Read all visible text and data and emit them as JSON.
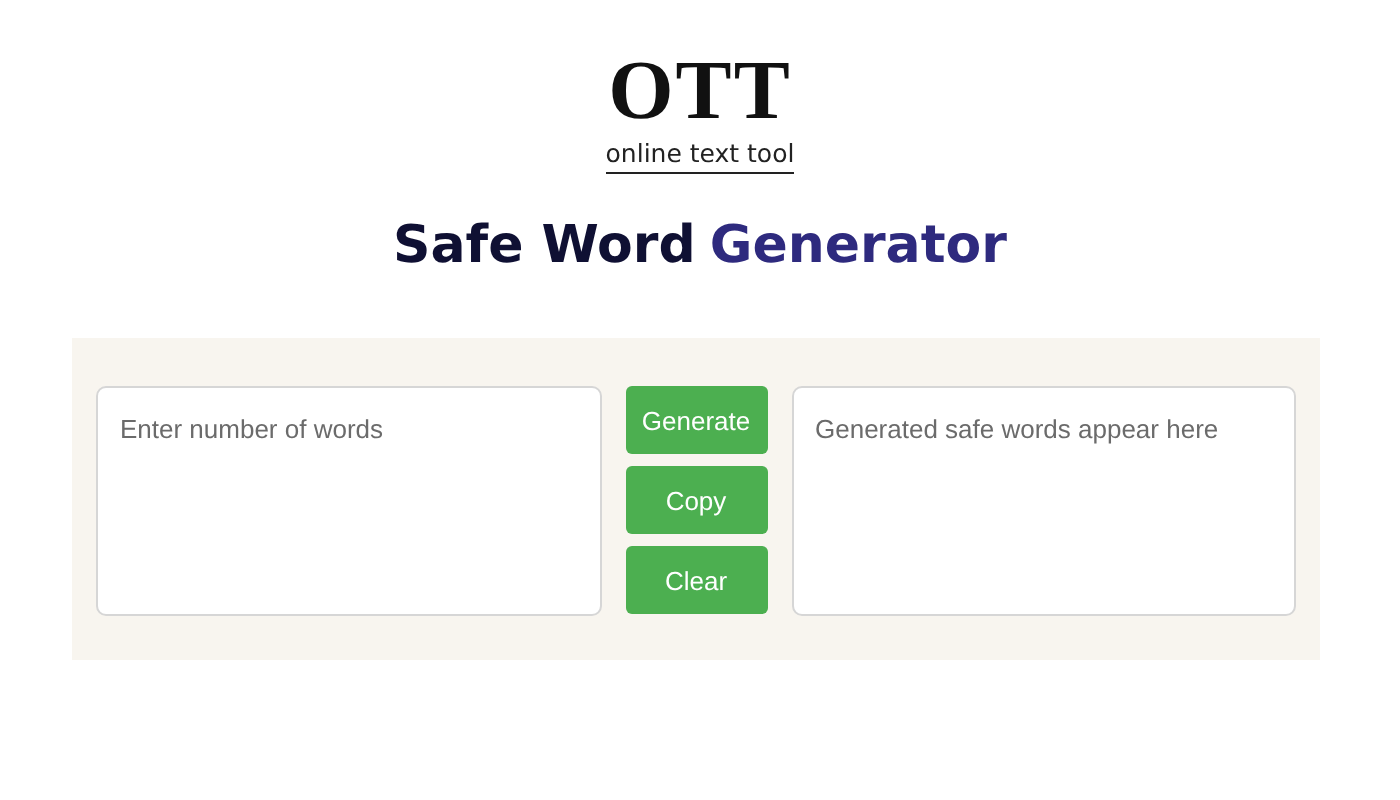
{
  "logo": {
    "mark": "OTT",
    "tagline": "online text tool"
  },
  "title": [
    {
      "text": "Safe Word",
      "kind": "plain"
    },
    {
      "text": "Generator",
      "kind": "accent"
    }
  ],
  "input": {
    "placeholder": "Enter number of words"
  },
  "buttons": [
    "Generate",
    "Copy",
    "Clear"
  ],
  "output": {
    "placeholder": "Generated safe words appear here"
  }
}
